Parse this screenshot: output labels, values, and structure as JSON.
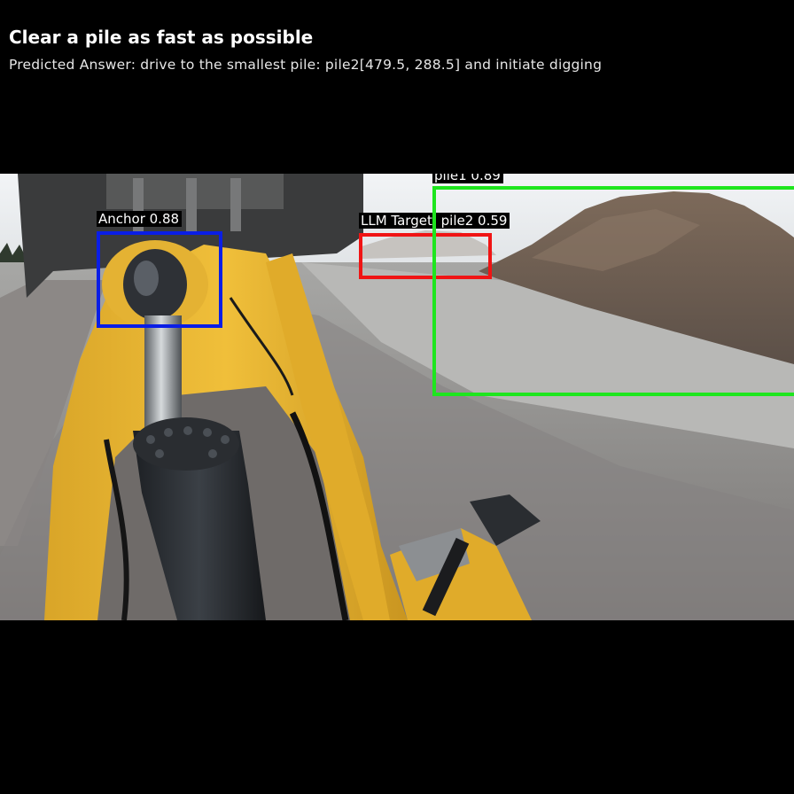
{
  "header": {
    "title": "Clear a pile as fast as possible",
    "answer": "Predicted Answer: drive to the smallest pile: pile2[479.5, 288.5] and initiate digging"
  },
  "detections": {
    "anchor": {
      "label": "Anchor 0.88",
      "color": "#0a1ee6"
    },
    "llm_target": {
      "label": "LLM Target: pile2 0.59",
      "color": "#f01414"
    },
    "pile1": {
      "label": "pile1 0.89",
      "color": "#1ee61e"
    }
  },
  "scene": {
    "description_icon": "wheel-loader-arm-camera"
  }
}
